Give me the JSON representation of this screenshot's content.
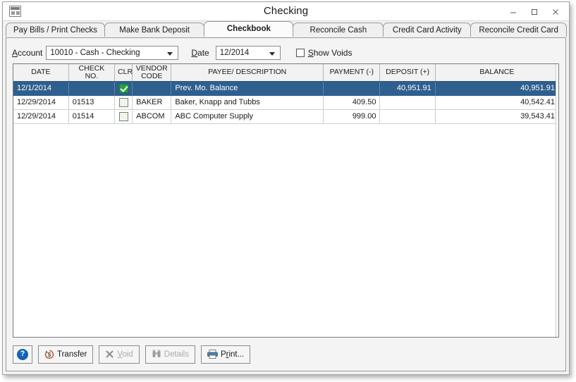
{
  "window": {
    "title": "Checking",
    "app_icon": "checkbook-window-icon",
    "controls": {
      "minimize": "minimize-icon",
      "maximize": "maximize-icon",
      "close": "close-icon"
    }
  },
  "tabs": [
    {
      "label": "Pay Bills / Print Checks",
      "active": false
    },
    {
      "label": "Make Bank Deposit",
      "active": false
    },
    {
      "label": "Checkbook",
      "active": true
    },
    {
      "label": "Reconcile Cash",
      "active": false
    },
    {
      "label": "Credit Card Activity",
      "active": false
    },
    {
      "label": "Reconcile Credit Card",
      "active": false
    }
  ],
  "filters": {
    "account_label": "Account",
    "account_value": "10010 - Cash - Checking",
    "date_label": "Date",
    "date_value": "12/2014",
    "show_voids_label": "Show Voids",
    "show_voids_checked": false
  },
  "grid": {
    "columns": [
      "DATE",
      "CHECK NO.",
      "CLR",
      "VENDOR CODE",
      "PAYEE/ DESCRIPTION",
      "PAYMENT (-)",
      "DEPOSIT (+)",
      "BALANCE"
    ],
    "rows": [
      {
        "date": "12/1/2014",
        "check_no": "",
        "clr": true,
        "vendor_code": "",
        "payee": "Prev. Mo. Balance",
        "payment": "",
        "deposit": "40,951.91",
        "balance": "40,951.91",
        "selected": true
      },
      {
        "date": "12/29/2014",
        "check_no": "01513",
        "clr": false,
        "vendor_code": "BAKER",
        "payee": "Baker, Knapp and Tubbs",
        "payment": "409.50",
        "deposit": "",
        "balance": "40,542.41",
        "selected": false
      },
      {
        "date": "12/29/2014",
        "check_no": "01514",
        "clr": false,
        "vendor_code": "ABCOM",
        "payee": "ABC Computer Supply",
        "payment": "999.00",
        "deposit": "",
        "balance": "39,543.41",
        "selected": false
      }
    ]
  },
  "buttons": {
    "help": {
      "label": "?",
      "icon": "help-icon",
      "enabled": true
    },
    "transfer": {
      "label": "Transfer",
      "icon": "transfer-icon",
      "enabled": true
    },
    "void": {
      "label": "Void",
      "icon": "x-icon",
      "enabled": false
    },
    "details": {
      "label": "Details",
      "icon": "binoculars-icon",
      "enabled": false
    },
    "print": {
      "label": "Print...",
      "icon": "printer-icon",
      "enabled": true
    }
  },
  "colors": {
    "selection": "#2e5f8f",
    "check_green": "#22a53a",
    "help_blue": "#1464b4",
    "window_bg": "#f2f2f2"
  }
}
